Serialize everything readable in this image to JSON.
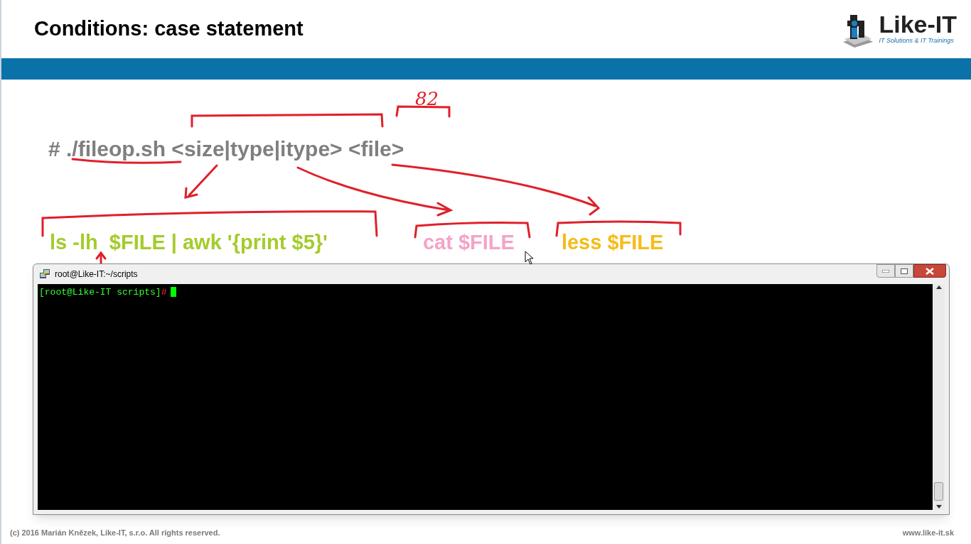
{
  "slide": {
    "title": "Conditions: case statement",
    "logo": {
      "name": "Like-IT",
      "tagline": "IT Solutions & IT Trainings"
    },
    "command": "# ./fileop.sh <size|type|itype> <file>",
    "annotation_text": "82",
    "options": [
      {
        "text": "ls -lh  $FILE | awk '{print $5}'",
        "color": "#a4cc2c"
      },
      {
        "text": "cat $FILE",
        "color": "#f5a3c7"
      },
      {
        "text": "less $FILE",
        "color": "#f6bc16"
      }
    ],
    "footer_left": "(c) 2016 Marián Knězek, Like-IT, s.r.o. All rights reserved.",
    "footer_right": "www.like-it.sk"
  },
  "terminal": {
    "title": "root@Like-IT:~/scripts",
    "prompt": "[root@Like-IT scripts]",
    "prompt_symbol": "#"
  }
}
